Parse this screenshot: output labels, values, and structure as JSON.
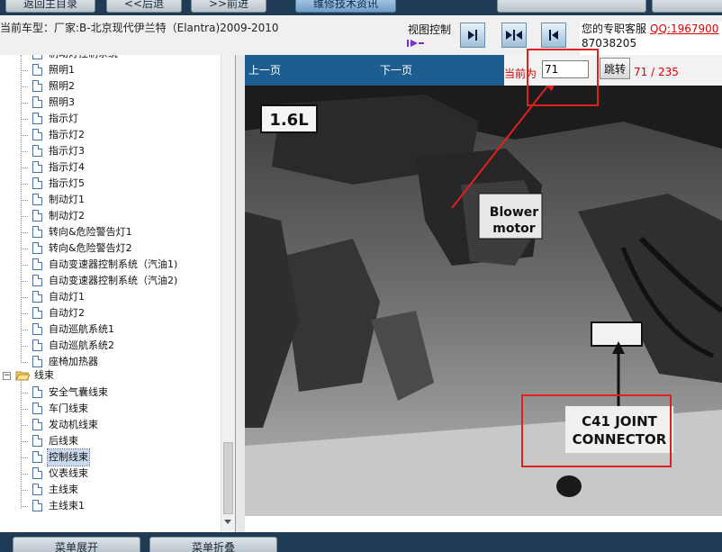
{
  "toolbar": {
    "buttons": [
      "返回主目录",
      "<<后退",
      ">>前进",
      "维修技术资讯",
      "",
      ""
    ]
  },
  "vehicle": {
    "label": "当前车型：厂家:B-北京现代伊兰特（Elantra)2009-2010"
  },
  "view_control": {
    "label": "视图控制"
  },
  "support": {
    "text": "您的专职客服",
    "qq": "QQ:1967900",
    "phone": "87038205"
  },
  "sidebar": {
    "items": [
      "制动灯控制系统",
      "照明1",
      "照明2",
      "照明3",
      "指示灯",
      "指示灯2",
      "指示灯3",
      "指示灯4",
      "指示灯5",
      "制动灯1",
      "制动灯2",
      "转向&危险警告灯1",
      "转向&危险警告灯2",
      "自动变速器控制系统（汽油1)",
      "自动变速器控制系统（汽油2)",
      "自动灯1",
      "自动灯2",
      "自动巡航系统1",
      "自动巡航系统2",
      "座椅加热器"
    ],
    "folder_label": "线束",
    "harness_items": [
      "安全气囊线束",
      "车门线束",
      "发动机线束",
      "后线束",
      "控制线束",
      "仪表线束",
      "主线束",
      "主线束1"
    ],
    "selected": "控制线束"
  },
  "viewer": {
    "prev_label": "上一页",
    "next_label": "下一页",
    "current_label": "当前为",
    "page_value": "71",
    "jump_label": "跳转",
    "page_count": "71 / 235"
  },
  "diagram": {
    "engine_label": "1.6L",
    "blower_label_1": "Blower",
    "blower_label_2": "motor",
    "connector_label_1": "C41 JOINT",
    "connector_label_2": "CONNECTOR",
    "annotation_color": "#e02020"
  },
  "bottombar": {
    "buttons": [
      "菜单展开",
      "菜单折叠"
    ]
  }
}
